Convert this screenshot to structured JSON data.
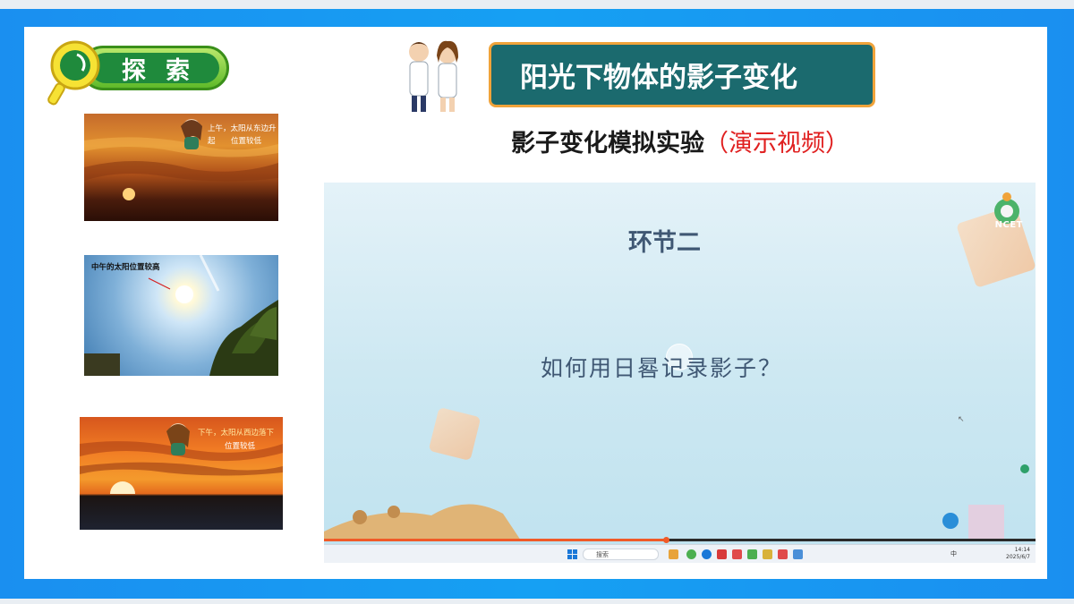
{
  "explore": {
    "label": "探索"
  },
  "title": {
    "main": "阳光下物体的影子变化"
  },
  "subtitle": {
    "text": "影子变化模拟实验",
    "note": "（演示视频）"
  },
  "photos": [
    {
      "caption_line1": "上午，太阳从东边升起",
      "caption_line2": "位置较低"
    },
    {
      "caption_line1": "中午的太阳位置较高"
    },
    {
      "caption_line1": "下午，太阳从西边落下",
      "caption_line2": "位置较低"
    }
  ],
  "video": {
    "heading": "环节二",
    "question": "如何用日晷记录影子？",
    "logo_text": "NCET",
    "progress_fraction": 0.48,
    "taskbar": {
      "search_placeholder": "搜索",
      "time": "14:14",
      "date": "2025/6/7",
      "ime": "中"
    }
  },
  "colors": {
    "frame": "#1a8ff0",
    "title_bg": "#1b6a6e",
    "title_border": "#f0a33a",
    "accent_red": "#e02020",
    "explore_green": "#1f8a3c"
  },
  "icons": [
    "magnifier-icon",
    "scientists-illustration",
    "play-icon",
    "windows-start-icon",
    "ncet-logo"
  ]
}
